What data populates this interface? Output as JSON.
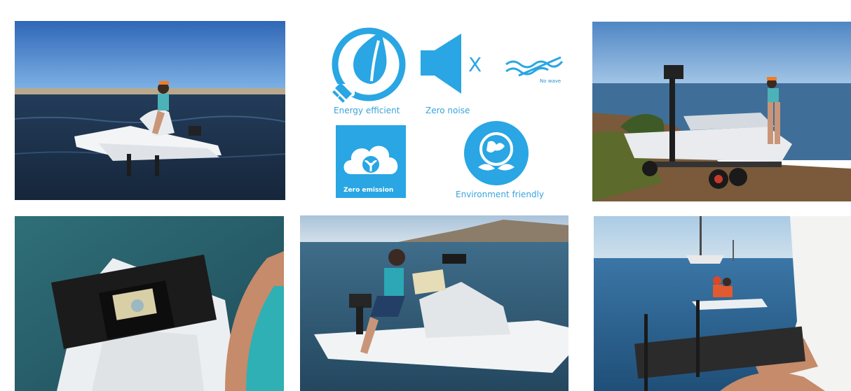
{
  "features": {
    "energy_efficient": "Energy efficient",
    "zero_noise": "Zero noise",
    "zero_noise_mark": "X",
    "no_wave": "No wave",
    "zero_emission": "Zero emission",
    "environment_friendly": "Environment friendly"
  },
  "colors": {
    "icon_blue": "#29a6e3",
    "caption_blue": "#39a3dc"
  },
  "photos": [
    "woman-riding-electric-hydrofoil-boat",
    "boat-on-trailer-at-shore",
    "dashboard-screen-closeup",
    "woman-seated-on-boat-at-sea",
    "remote-controlled-boat-with-sailboat"
  ]
}
